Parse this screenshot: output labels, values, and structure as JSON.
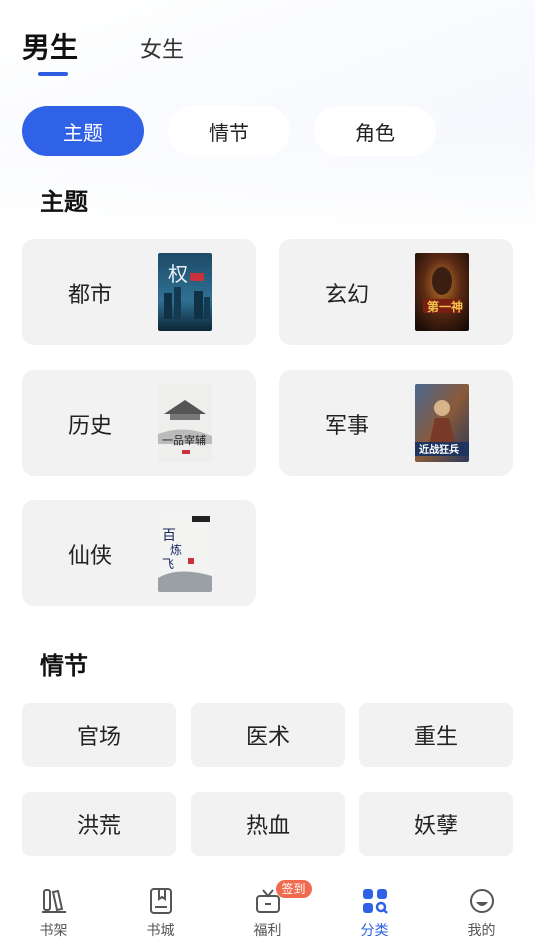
{
  "gender_tabs": [
    {
      "label": "男生",
      "active": true
    },
    {
      "label": "女生",
      "active": false
    }
  ],
  "pills": [
    {
      "label": "主题",
      "active": true
    },
    {
      "label": "情节",
      "active": false
    },
    {
      "label": "角色",
      "active": false
    }
  ],
  "theme_section": {
    "title": "主题",
    "cards": [
      {
        "label": "都市",
        "cover": "book-cover-city"
      },
      {
        "label": "玄幻",
        "cover": "book-cover-fantasy"
      },
      {
        "label": "历史",
        "cover": "book-cover-history"
      },
      {
        "label": "军事",
        "cover": "book-cover-military"
      },
      {
        "label": "仙侠",
        "cover": "book-cover-xianxia"
      }
    ]
  },
  "plot_section": {
    "title": "情节",
    "items": [
      "官场",
      "医术",
      "重生",
      "洪荒",
      "热血",
      "妖孽"
    ]
  },
  "bottom_nav": [
    {
      "label": "书架",
      "icon": "bookshelf-icon",
      "active": false
    },
    {
      "label": "书城",
      "icon": "book-icon",
      "active": false
    },
    {
      "label": "福利",
      "icon": "gift-icon",
      "active": false,
      "badge": "签到"
    },
    {
      "label": "分类",
      "icon": "category-icon",
      "active": true
    },
    {
      "label": "我的",
      "icon": "profile-icon",
      "active": false
    }
  ],
  "colors": {
    "accent": "#2f62e6",
    "badge": "#ef6a4e",
    "card": "#f2f2f3"
  }
}
